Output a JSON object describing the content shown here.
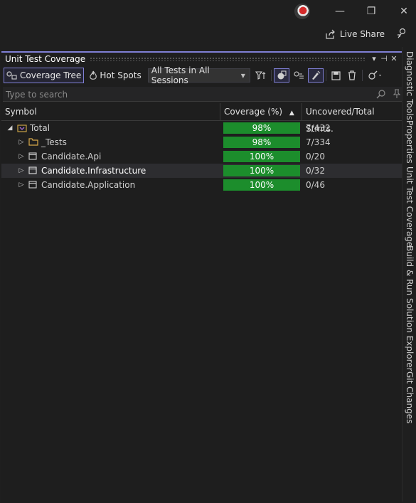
{
  "window": {
    "minimize_glyph": "—",
    "restore_glyph": "❐",
    "close_glyph": "✕"
  },
  "header": {
    "live_share_label": "Live Share"
  },
  "pane": {
    "title": "Unit Test Coverage",
    "menu_glyph": "▾",
    "pin_glyph": "⊣",
    "close_glyph": "✕"
  },
  "toolbar": {
    "coverage_tree_label": "Coverage Tree",
    "hot_spots_label": "Hot Spots",
    "session_select_value": "All Tests in All Sessions"
  },
  "search": {
    "placeholder": "Type to search"
  },
  "grid": {
    "columns": [
      "Symbol",
      "Coverage (%)",
      "Uncovered/Total Stmts."
    ],
    "sort_glyph": "▲",
    "rows": [
      {
        "name": "Total",
        "coverage": "98%",
        "stmts": "7/432",
        "expander": "◢"
      },
      {
        "name": "_Tests",
        "coverage": "98%",
        "stmts": "7/334",
        "expander": "▷"
      },
      {
        "name": "Candidate.Api",
        "coverage": "100%",
        "stmts": "0/20",
        "expander": "▷"
      },
      {
        "name": "Candidate.Infrastructure",
        "coverage": "100%",
        "stmts": "0/32",
        "expander": "▷"
      },
      {
        "name": "Candidate.Application",
        "coverage": "100%",
        "stmts": "0/46",
        "expander": "▷"
      }
    ]
  },
  "rail": {
    "tabs": [
      "Diagnostic Tools",
      "Properties",
      "Unit Test Coverage",
      "Build & Run",
      "Solution Explorer",
      "Git Changes"
    ]
  },
  "colors": {
    "accent": "#7f7fd5",
    "coverage_bar": "#1c8d2c",
    "background": "#1e1e1e"
  }
}
